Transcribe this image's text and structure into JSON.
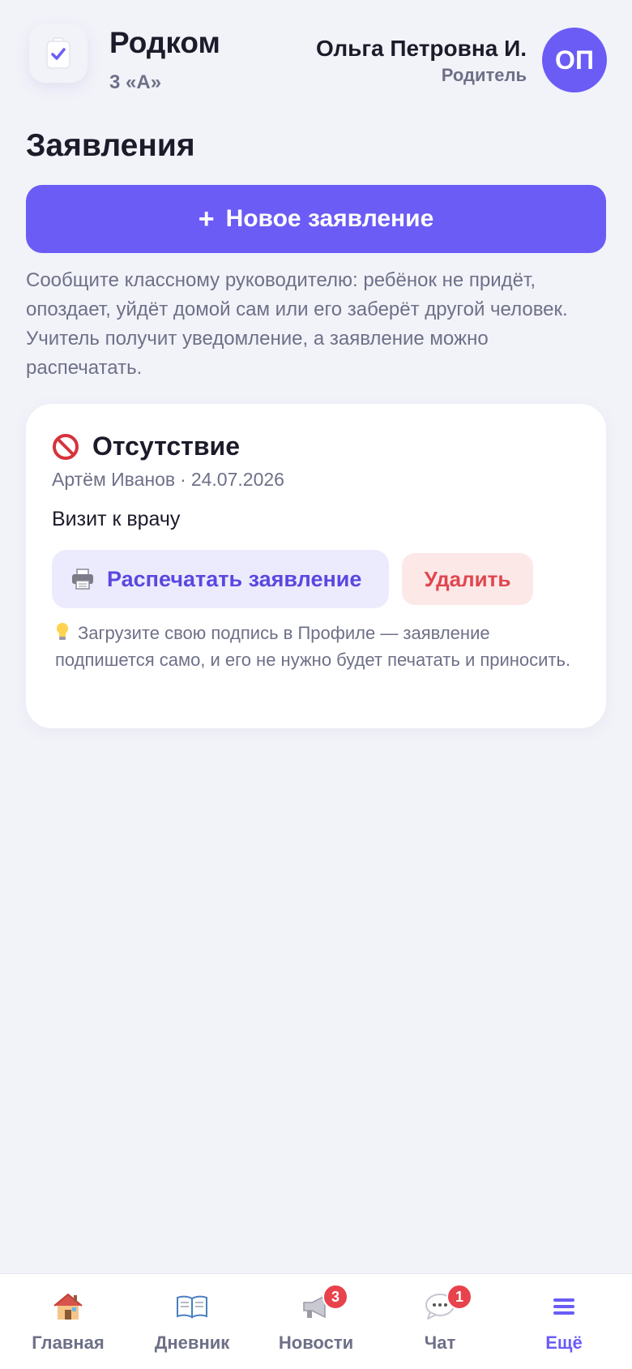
{
  "header": {
    "app_name": "Родком",
    "class_name": "3 «А»",
    "user_name": "Ольга Петровна И.",
    "user_role": "Родитель",
    "avatar_initials": "ОП",
    "logo_icon": "clipboard-check-icon"
  },
  "page": {
    "title": "Заявления",
    "new_button_icon": "+",
    "new_button_label": "Новое заявление",
    "hint": "Сообщите классному руководителю: ребёнок не придёт, опоздает, уйдёт домой сам или его заберёт другой человек. Учитель получит уведомление, а заявление можно распечатать."
  },
  "applications": [
    {
      "type_icon": "no-entry-icon",
      "type": "Отсутствие",
      "student": "Артём Иванов",
      "separator": "·",
      "date": "24.07.2026",
      "reason": "Визит к врачу",
      "print_label": "Распечатать заявление",
      "delete_label": "Удалить",
      "tip": "Загрузите свою подпись в Профиле — заявление подпишется само, и его не нужно будет печатать и приносить."
    }
  ],
  "nav": {
    "items": [
      {
        "label": "Главная",
        "icon": "house-icon"
      },
      {
        "label": "Дневник",
        "icon": "book-icon"
      },
      {
        "label": "Новости",
        "icon": "megaphone-icon",
        "badge": "3"
      },
      {
        "label": "Чат",
        "icon": "chat-bubble-icon",
        "badge": "1"
      },
      {
        "label": "Ещё",
        "icon": "menu-icon",
        "active": true
      }
    ]
  },
  "colors": {
    "accent": "#6b5cf6",
    "background": "#f2f3f9",
    "danger": "#e0464f",
    "badge": "#e8424c"
  }
}
